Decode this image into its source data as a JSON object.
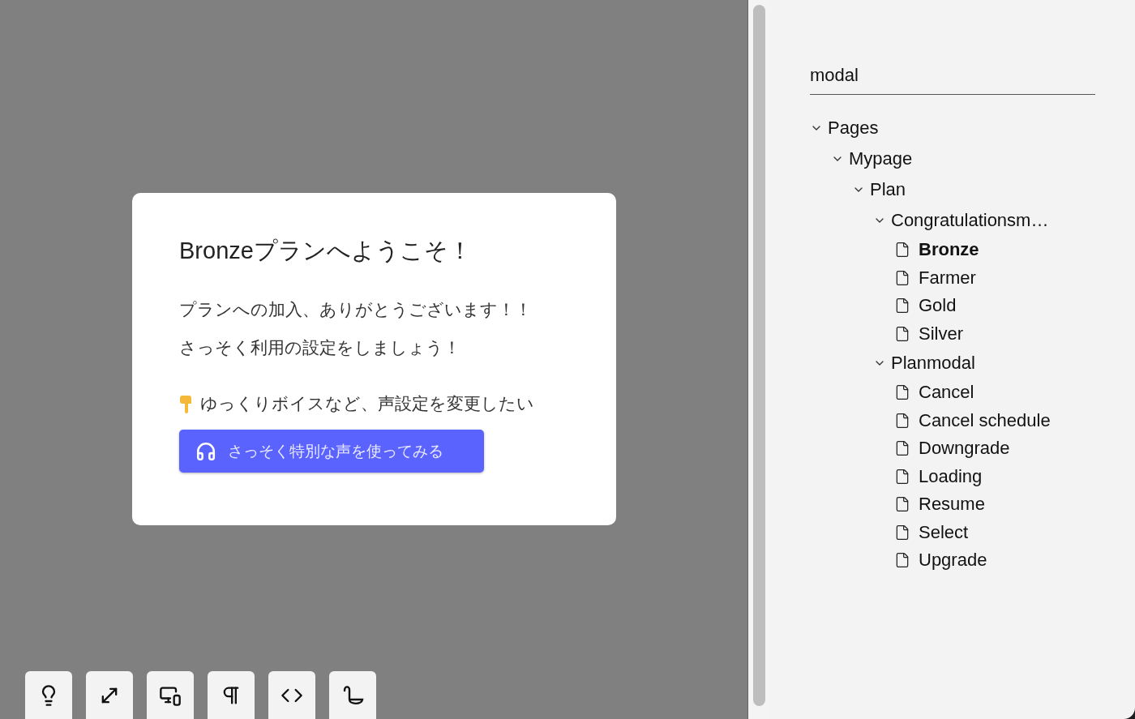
{
  "preview": {
    "card": {
      "title": "Bronzeプランへようこそ！",
      "lines": [
        "プランへの加入、ありがとうございます！！",
        "さっそく利用の設定をしましょう！"
      ],
      "hint": "ゆっくりボイスなど、声設定を変更したい",
      "button": "さっそく特別な声を使ってみる"
    }
  },
  "toolbar": [
    {
      "kind": "bulb"
    },
    {
      "kind": "expand"
    },
    {
      "kind": "devices"
    },
    {
      "kind": "pilcrow"
    },
    {
      "kind": "code"
    },
    {
      "kind": "hook"
    }
  ],
  "sidebar": {
    "search": {
      "value": "modal"
    },
    "tree": [
      {
        "kind": "folder",
        "label": "Pages",
        "expanded": true,
        "children": [
          {
            "kind": "folder",
            "label": "Mypage",
            "expanded": true,
            "children": [
              {
                "kind": "folder",
                "label": "Plan",
                "expanded": true,
                "children": [
                  {
                    "kind": "folder",
                    "label": "Congratulationsm…",
                    "expanded": true,
                    "children": [
                      {
                        "kind": "page",
                        "label": "Bronze",
                        "selected": true
                      },
                      {
                        "kind": "page",
                        "label": "Farmer",
                        "selected": false
                      },
                      {
                        "kind": "page",
                        "label": "Gold",
                        "selected": false
                      },
                      {
                        "kind": "page",
                        "label": "Silver",
                        "selected": false
                      }
                    ]
                  },
                  {
                    "kind": "folder",
                    "label": "Planmodal",
                    "expanded": true,
                    "children": [
                      {
                        "kind": "page",
                        "label": "Cancel",
                        "selected": false
                      },
                      {
                        "kind": "page",
                        "label": "Cancel schedule",
                        "selected": false
                      },
                      {
                        "kind": "page",
                        "label": "Downgrade",
                        "selected": false
                      },
                      {
                        "kind": "page",
                        "label": "Loading",
                        "selected": false
                      },
                      {
                        "kind": "page",
                        "label": "Resume",
                        "selected": false
                      },
                      {
                        "kind": "page",
                        "label": "Select",
                        "selected": false
                      },
                      {
                        "kind": "page",
                        "label": "Upgrade",
                        "selected": false
                      }
                    ]
                  }
                ]
              }
            ]
          }
        ]
      }
    ]
  }
}
